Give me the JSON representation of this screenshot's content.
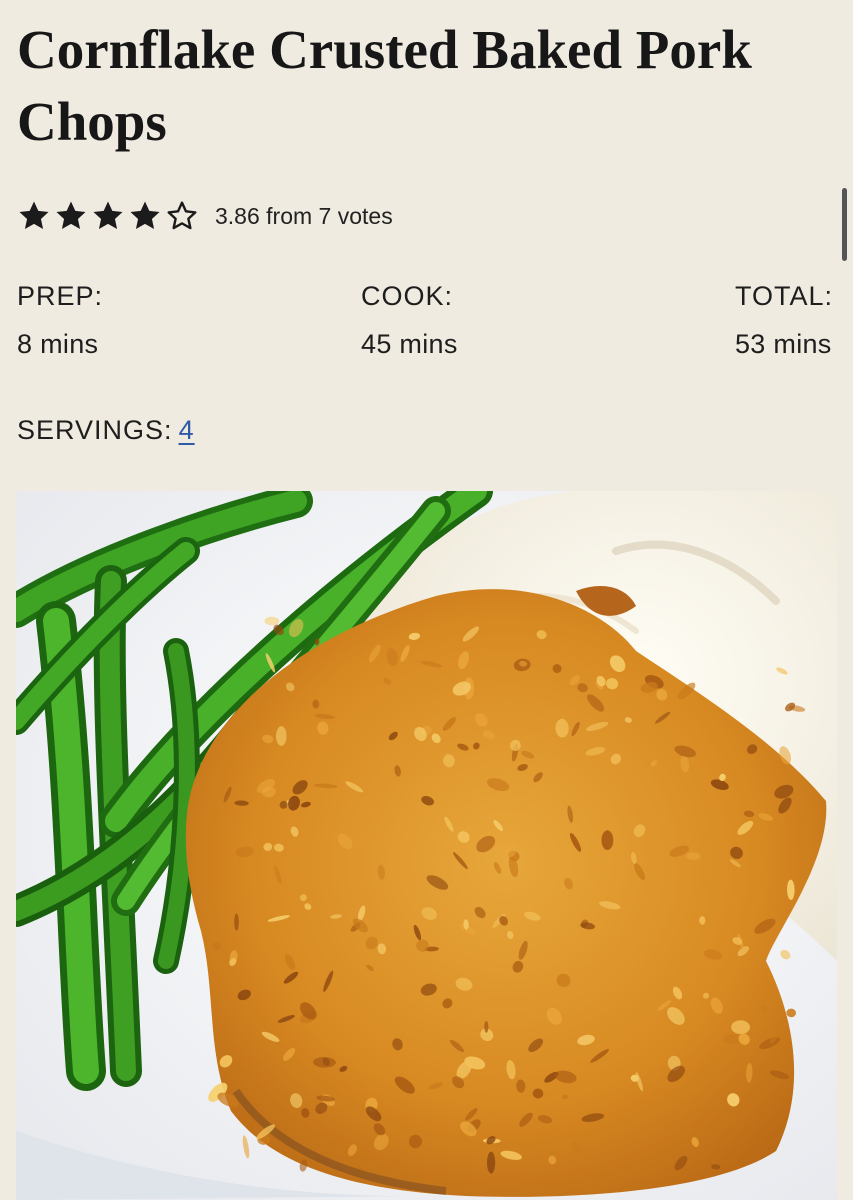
{
  "recipe": {
    "title": "Cornflake Crusted Baked Pork Chops",
    "rating": {
      "value": 3.86,
      "max": 5,
      "text": "3.86 from 7 votes",
      "star_icons": [
        "star-filled",
        "star-filled",
        "star-filled",
        "star-filled",
        "star-outline"
      ]
    },
    "times": {
      "prep_label": "PREP:",
      "prep_value": "8 mins",
      "cook_label": "COOK:",
      "cook_value": "45 mins",
      "total_label": "TOTAL:",
      "total_value": "53 mins"
    },
    "servings": {
      "label": "SERVINGS:",
      "value": "4"
    }
  },
  "colors": {
    "background": "#f0ebe1",
    "link": "#2f5aa8",
    "text": "#1b1b1b"
  }
}
